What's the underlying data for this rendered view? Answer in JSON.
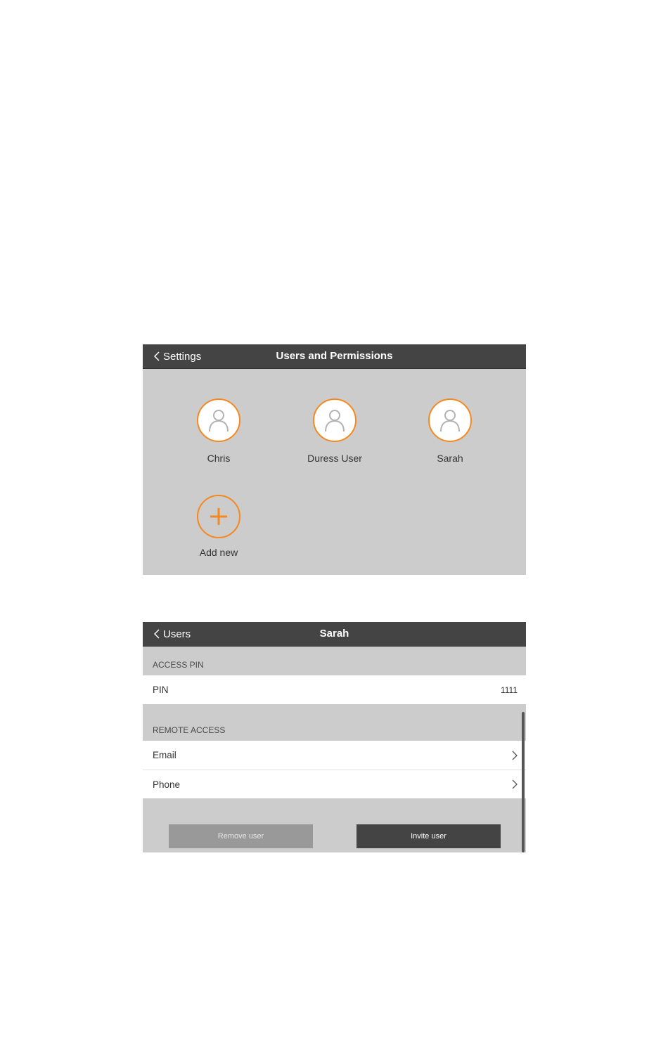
{
  "users_screen": {
    "back_label": "Settings",
    "title": "Users and Permissions",
    "users": [
      {
        "name": "Chris",
        "icon": "user-icon"
      },
      {
        "name": "Duress User",
        "icon": "user-icon"
      },
      {
        "name": "Sarah",
        "icon": "user-icon"
      }
    ],
    "add_new_label": "Add new",
    "accent_color": "#f5881f"
  },
  "user_detail": {
    "back_label": "Users",
    "title": "Sarah",
    "access_pin": {
      "section_label": "ACCESS PIN",
      "pin_label": "PIN",
      "pin_value": "1111"
    },
    "remote_access": {
      "section_label": "REMOTE ACCESS",
      "items": [
        {
          "label": "Email"
        },
        {
          "label": "Phone"
        }
      ]
    },
    "remove_label": "Remove user",
    "invite_label": "Invite user"
  }
}
